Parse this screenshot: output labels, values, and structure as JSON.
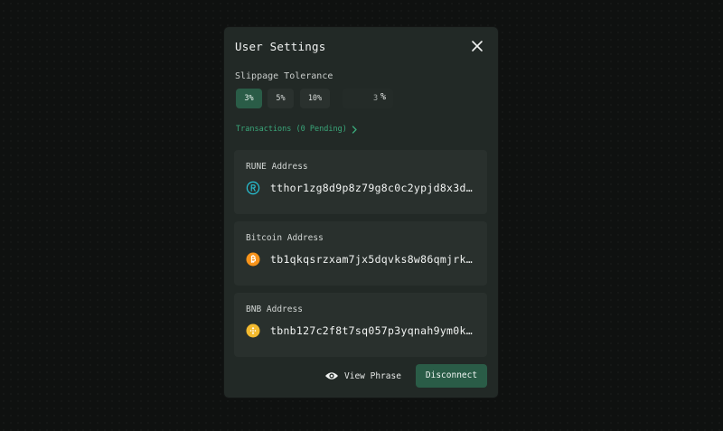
{
  "modal": {
    "title": "User Settings",
    "close_icon": "close-icon"
  },
  "slippage": {
    "label": "Slippage Tolerance",
    "options": [
      "3%",
      "5%",
      "10%"
    ],
    "selected": "3%",
    "custom_value": "3",
    "custom_suffix": "%"
  },
  "transactions": {
    "link_label": "Transactions (0 Pending)",
    "icon": "chevron-right-icon"
  },
  "addresses": [
    {
      "label": "RUNE Address",
      "value": "tthor1zg8d9p8z79g8c0c2ypjd8x3d…",
      "icon": "rune-icon",
      "color": "#27c3d6"
    },
    {
      "label": "Bitcoin Address",
      "value": "tb1qkqsrzxam7jx5dqvks8w86qmjrk…",
      "icon": "bitcoin-icon",
      "color": "#f7931a"
    },
    {
      "label": "BNB Address",
      "value": "tbnb127c2f8t7sq057p3yqnah9ym0k…",
      "icon": "bnb-icon",
      "color": "#f3ba2f"
    }
  ],
  "footer": {
    "view_phrase_label": "View Phrase",
    "view_icon": "eye-icon",
    "disconnect_label": "Disconnect"
  },
  "colors": {
    "accent": "#2a5c47",
    "link": "#3aa77a",
    "modal_bg": "#222926",
    "card_bg": "#29302d"
  }
}
